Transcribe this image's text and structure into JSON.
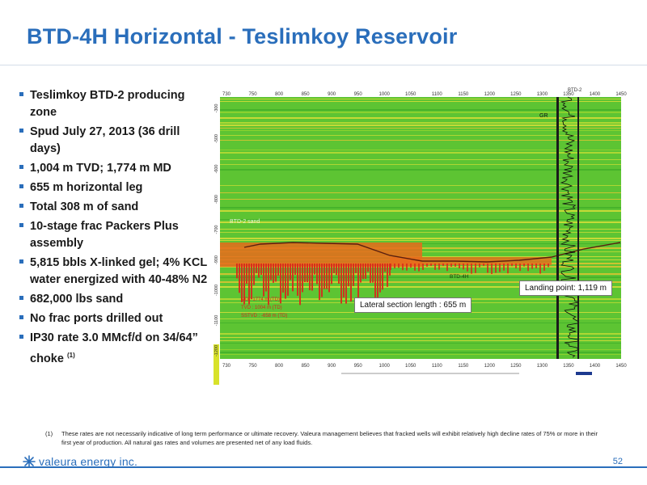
{
  "slide": {
    "title": "BTD-4H Horizontal - Teslimkoy Reservoir",
    "bullets": [
      {
        "text": "Teslimkoy BTD-2 producing zone"
      },
      {
        "text": "Spud July 27, 2013 (36 drill days)"
      },
      {
        "text": "1,004 m TVD; 1,774 m MD"
      },
      {
        "text": "655 m horizontal leg"
      },
      {
        "text": "Total 308 m of sand"
      },
      {
        "text": "10-stage frac Packers Plus assembly"
      },
      {
        "text": "5,815 bbls X-linked gel; 4% KCL water energized with 40-48% N2"
      },
      {
        "text": "682,000 lbs sand"
      },
      {
        "text": "No frac ports drilled out"
      },
      {
        "text": "IP30 rate 3.0 MMcf/d on 34/64” choke",
        "sup": "(1)"
      }
    ],
    "footnote": {
      "marker": "(1)",
      "text": "These rates are not necessarily indicative of long term performance or ultimate recovery. Valeura management believes that fracked wells will exhibit relatively high decline rates of 75% or more in their first year of production. All natural gas rates and volumes are presented net of any load fluids."
    },
    "page_number": "52",
    "logo_text": "valeura energy inc."
  },
  "figure": {
    "x_ticks": [
      "730",
      "750",
      "800",
      "850",
      "900",
      "950",
      "1000",
      "1050",
      "1100",
      "1150",
      "1200",
      "1250",
      "1300",
      "1350",
      "1400",
      "1450"
    ],
    "y_ticks": [
      "-300",
      "-500",
      "-600",
      "-800",
      "-700",
      "-900",
      "-1000",
      "-1100",
      "-1200"
    ],
    "callouts": {
      "landing_point": "Landing point: 1,119 m",
      "lateral_length": "Lateral section length : 655  m"
    },
    "annotations": {
      "sand_label": "BTD-2 sand",
      "gr_label": "GR",
      "well_label": "BTD-4H ",
      "top_right_label": "BTD-2",
      "md_line": "MD : 1774 m (TD)",
      "tvd_line": "TVD : 1004 m (TD)",
      "sstvd_line": "SSTVD : -658 m (TD)"
    },
    "colors": {
      "background_green": "#5dc433",
      "band_yellow": "#e8e23a",
      "band_orange": "#e86b1c",
      "band_red": "#d9261c",
      "brand_blue": "#2a6ebb"
    }
  }
}
